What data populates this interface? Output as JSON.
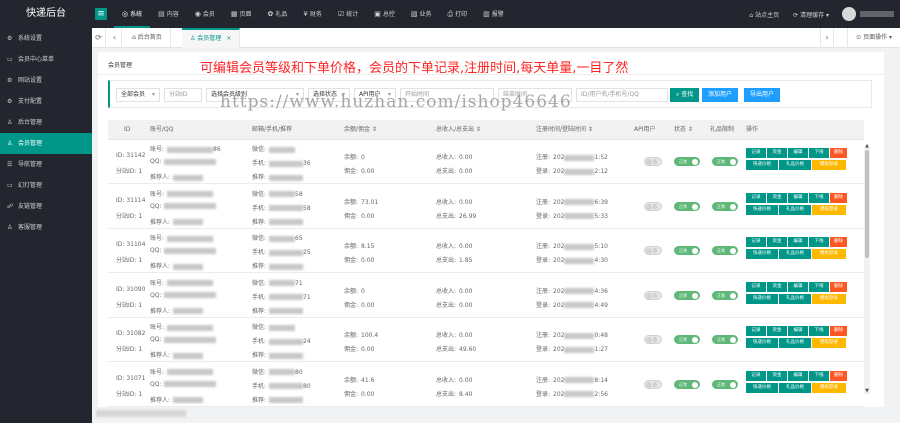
{
  "app": {
    "title": "快递后台"
  },
  "topnav": [
    {
      "label": "系统",
      "icon": "◎",
      "icon_name": "gauge-icon",
      "active": true
    },
    {
      "label": "内容",
      "icon": "▤",
      "icon_name": "content-icon"
    },
    {
      "label": "会员",
      "icon": "◉",
      "icon_name": "member-icon"
    },
    {
      "label": "页面",
      "icon": "▦",
      "icon_name": "page-icon"
    },
    {
      "label": "礼品",
      "icon": "✿",
      "icon_name": "gift-icon"
    },
    {
      "label": "财务",
      "icon": "¥",
      "icon_name": "finance-icon"
    },
    {
      "label": "统计",
      "icon": "☑",
      "icon_name": "stats-icon"
    },
    {
      "label": "总控",
      "icon": "▣",
      "icon_name": "control-icon"
    },
    {
      "label": "业务",
      "icon": "▧",
      "icon_name": "business-icon"
    },
    {
      "label": "打印",
      "icon": "⎙",
      "icon_name": "print-icon"
    },
    {
      "label": "报警",
      "icon": "▥",
      "icon_name": "alarm-icon"
    }
  ],
  "topright": {
    "site_home": "站点主页",
    "clear_cache": "清理缓存 ▾"
  },
  "sidebar": [
    {
      "label": "系统设置",
      "icon": "⚙"
    },
    {
      "label": "会员中心菜单",
      "icon": "▭"
    },
    {
      "label": "网站设置",
      "icon": "⚙"
    },
    {
      "label": "支付配置",
      "icon": "⚙"
    },
    {
      "label": "后台管理",
      "icon": "♙"
    },
    {
      "label": "会员管理",
      "icon": "♙",
      "active": true
    },
    {
      "label": "导航管理",
      "icon": "☰"
    },
    {
      "label": "幻灯管理",
      "icon": "▭"
    },
    {
      "label": "友链管理",
      "icon": "☍"
    },
    {
      "label": "客服管理",
      "icon": "♙"
    }
  ],
  "tabs": {
    "home": "后台首页",
    "member": "会员管理",
    "close": "×",
    "page_ops": "⊙ 页面操作 ▾"
  },
  "panel": {
    "title": "会员管理",
    "banner": "可编辑会员等级和下单价格，会员的下单记录,注册时间,每天单量,一目了然"
  },
  "filters": {
    "member_select": "全部会员",
    "group_id": "分站ID",
    "level": "选择会员级别",
    "status": "选择状态",
    "api": "API用户",
    "start_time": "开始时间",
    "end_time": "结束时间",
    "keyword": "ID/用户名/手机号/QQ",
    "search_btn": "查找",
    "add_btn": "添加用户",
    "export_btn": "导出用户"
  },
  "watermark": "https://www.huzhan.com/ishop46646",
  "table": {
    "headers": [
      "ID",
      "账号/QQ",
      "邮箱/手机/推荐",
      "余额/佣金 ⇕",
      "总收入/总支出 ⇕",
      "注册时间/登陆时间 ⇕",
      "API用户",
      "状态 ⇕",
      "礼品限制",
      "操作"
    ],
    "labels": {
      "account": "账号:",
      "qq": "QQ:",
      "referrer": "推荐人:",
      "wechat": "微信:",
      "phone": "手机:",
      "referral": "推荐:",
      "balance": "余额:",
      "commission": "佣金:",
      "income": "总收入:",
      "expense": "总支出:",
      "register": "注册:",
      "login": "登录:",
      "toggle_no": "否",
      "toggle_normal": "正常"
    },
    "actions_row1": [
      "记录",
      "资金",
      "编辑",
      "下线",
      "删除"
    ],
    "actions_row2": [
      "快递价格",
      "礼品价格",
      "模拟登录"
    ],
    "rows": [
      {
        "id": "ID: 31142",
        "group": "分站ID: 1",
        "acc_tail": "86",
        "phone_tail": "36",
        "balance": "0",
        "commission": "0.00",
        "income": "0.00",
        "expense": "0.00",
        "reg_prefix": "202",
        "reg_tail": "1:52",
        "login_tail": "2:12"
      },
      {
        "id": "ID: 31114",
        "group": "分站ID: 1",
        "acc_tail": "",
        "qq_prefix": "57",
        "wx_tail": "58",
        "phone_tail": "58",
        "balance": "73.01",
        "commission": "0.00",
        "income": "0.00",
        "expense": "26.99",
        "reg_prefix": "202",
        "reg_tail": "6:39",
        "login_tail": "5:33"
      },
      {
        "id": "ID: 31104",
        "group": "分站ID: 1",
        "acc_tail": "",
        "qq_prefix": "90",
        "wx_tail": "65",
        "phone_tail": "25",
        "balance": "8.15",
        "commission": "0.00",
        "income": "0.00",
        "expense": "1.85",
        "reg_prefix": "202",
        "reg_tail": "5:10",
        "login_tail": "4:30"
      },
      {
        "id": "ID: 31090",
        "group": "分站ID: 1",
        "acc_tail": "",
        "qq_prefix": "1",
        "wx_tail": "71",
        "phone_tail": "71",
        "balance": "0",
        "commission": "0.00",
        "income": "0.00",
        "expense": "0.00",
        "reg_prefix": "202",
        "reg_tail": "4:36",
        "login_tail": "4:49"
      },
      {
        "id": "ID: 31082",
        "group": "分站ID: 1",
        "acc_tail": "",
        "qq_prefix": "1",
        "wx_tail": "",
        "phone_tail": "24",
        "balance": "100.4",
        "commission": "0.00",
        "income": "0.00",
        "expense": "49.60",
        "reg_prefix": "202",
        "reg_tail": "0:48",
        "login_tail": "1:27"
      },
      {
        "id": "ID: 31071",
        "group": "分站ID: 1",
        "acc_tail": "",
        "qq_prefix": "63",
        "wx_tail": "80",
        "phone_tail": "80",
        "balance": "41.6",
        "commission": "0.00",
        "income": "0.00",
        "expense": "8.40",
        "reg_prefix": "202",
        "reg_tail": "8:14",
        "login_tail": "2:56"
      }
    ]
  },
  "colors": {
    "accent": "#009688",
    "blue": "#1e9fff",
    "red": "#ff5722",
    "yellow": "#ffb800",
    "banner": "#ff2424",
    "dark": "#23262e"
  }
}
